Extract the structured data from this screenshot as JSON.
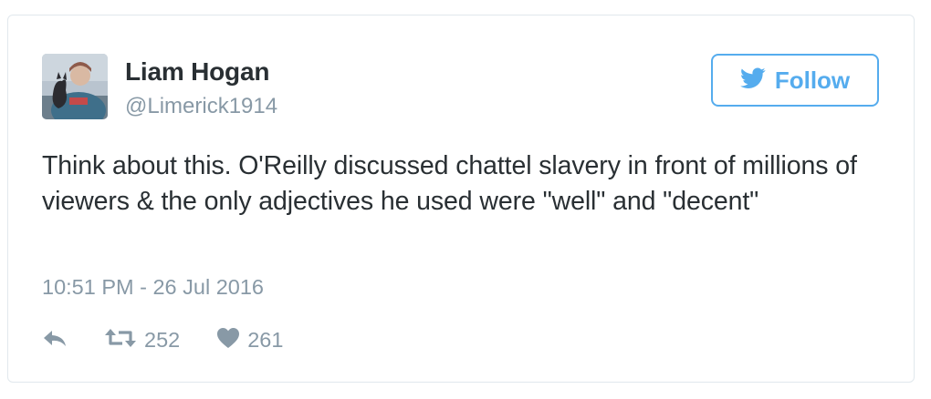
{
  "author": {
    "name": "Liam Hogan",
    "handle": "@Limerick1914",
    "avatar_icon": "profile-photo"
  },
  "follow_button": {
    "label": "Follow",
    "icon": "twitter-bird-icon",
    "color": "#55acee"
  },
  "tweet": {
    "text": "Think about this. O'Reilly discussed chattel slavery in front of millions of viewers & the only adjectives he used were \"well\" and \"decent\"",
    "timestamp": "10:51 PM - 26 Jul 2016"
  },
  "actions": {
    "reply_icon": "reply-icon",
    "retweet_icon": "retweet-icon",
    "retweet_count": "252",
    "like_icon": "heart-icon",
    "like_count": "261"
  },
  "colors": {
    "text": "#292f33",
    "muted": "#8899a6",
    "accent": "#55acee",
    "border": "#e1e8ed"
  }
}
